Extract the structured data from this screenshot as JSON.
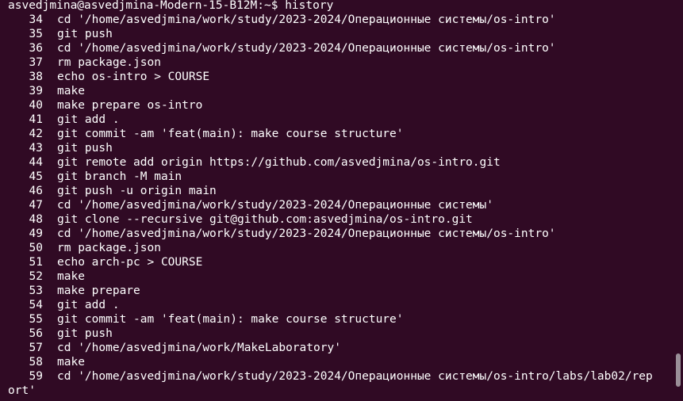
{
  "terminal": {
    "prompt": "asvedjmina@asvedjmina-Modern-15-B12M:~$ history",
    "entries": [
      {
        "num": "34",
        "cmd": "cd '/home/asvedjmina/work/study/2023-2024/Операционные системы/os-intro'"
      },
      {
        "num": "35",
        "cmd": "git push"
      },
      {
        "num": "36",
        "cmd": "cd '/home/asvedjmina/work/study/2023-2024/Операционные системы/os-intro'"
      },
      {
        "num": "37",
        "cmd": "rm package.json"
      },
      {
        "num": "38",
        "cmd": "echo os-intro > COURSE"
      },
      {
        "num": "39",
        "cmd": "make"
      },
      {
        "num": "40",
        "cmd": "make prepare os-intro"
      },
      {
        "num": "41",
        "cmd": "git add ."
      },
      {
        "num": "42",
        "cmd": "git commit -am 'feat(main): make course structure'"
      },
      {
        "num": "43",
        "cmd": "git push"
      },
      {
        "num": "44",
        "cmd": "git remote add origin https://github.com/asvedjmina/os-intro.git"
      },
      {
        "num": "45",
        "cmd": "git branch -M main"
      },
      {
        "num": "46",
        "cmd": "git push -u origin main"
      },
      {
        "num": "47",
        "cmd": "cd '/home/asvedjmina/work/study/2023-2024/Операционные системы'"
      },
      {
        "num": "48",
        "cmd": "git clone --recursive git@github.com:asvedjmina/os-intro.git"
      },
      {
        "num": "49",
        "cmd": "cd '/home/asvedjmina/work/study/2023-2024/Операционные системы/os-intro'"
      },
      {
        "num": "50",
        "cmd": "rm package.json"
      },
      {
        "num": "51",
        "cmd": "echo arch-pc > COURSE"
      },
      {
        "num": "52",
        "cmd": "make"
      },
      {
        "num": "53",
        "cmd": "make prepare"
      },
      {
        "num": "54",
        "cmd": "git add ."
      },
      {
        "num": "55",
        "cmd": "git commit -am 'feat(main): make course structure'"
      },
      {
        "num": "56",
        "cmd": "git push"
      },
      {
        "num": "57",
        "cmd": "cd '/home/asvedjmina/work/MakeLaboratory'"
      },
      {
        "num": "58",
        "cmd": "make"
      },
      {
        "num": "59",
        "cmd": "cd '/home/asvedjmina/work/study/2023-2024/Операционные системы/os-intro/labs/lab02/rep"
      }
    ],
    "wrap_continuation": "ort'"
  },
  "colors": {
    "background": "#300a24",
    "text": "#ffffff",
    "scrollbar_thumb": "#9a8f98"
  }
}
